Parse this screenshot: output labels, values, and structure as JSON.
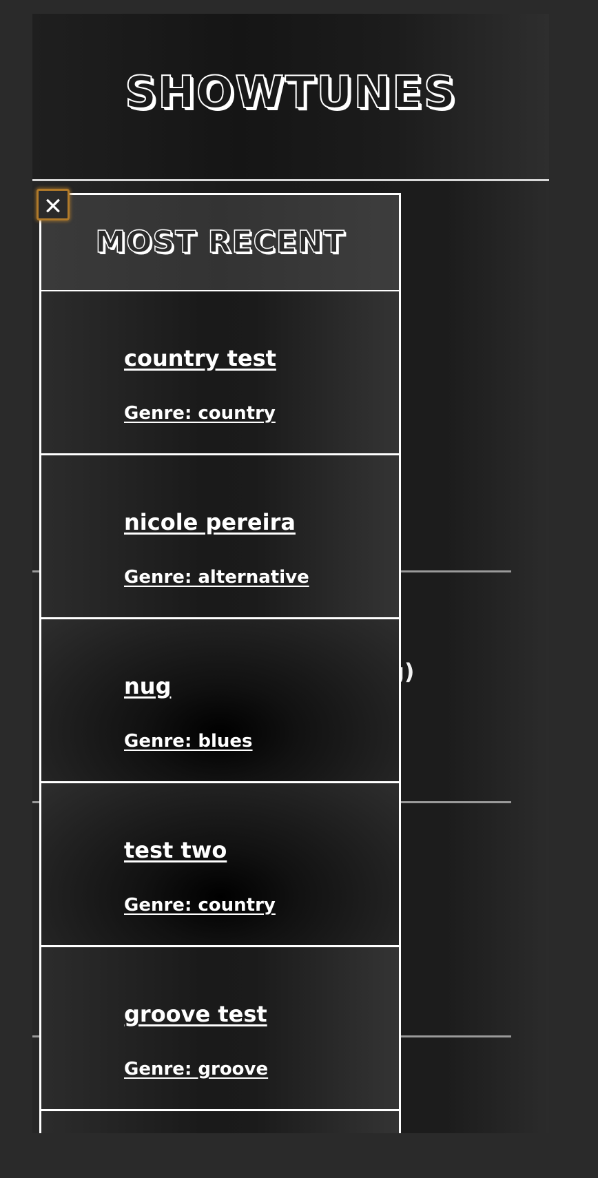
{
  "site": {
    "title": "SHOWTUNES"
  },
  "drawer": {
    "title": "MOST RECENT",
    "close_icon": "close-icon",
    "close_glyph": "✕",
    "items": [
      {
        "title": "country test",
        "genre": "Genre: country"
      },
      {
        "title": "nicole pereira",
        "genre": "Genre: alternative"
      },
      {
        "title": "nug",
        "genre": "Genre: blues"
      },
      {
        "title": "test two",
        "genre": "Genre: country"
      },
      {
        "title": "groove test",
        "genre": "Genre: groove"
      }
    ]
  },
  "background_feed": {
    "fragments": [
      ".",
      "g)"
    ]
  },
  "colors": {
    "background": "#2a2a2a",
    "text": "#ffffff",
    "focus_ring": "#b07a2a"
  }
}
